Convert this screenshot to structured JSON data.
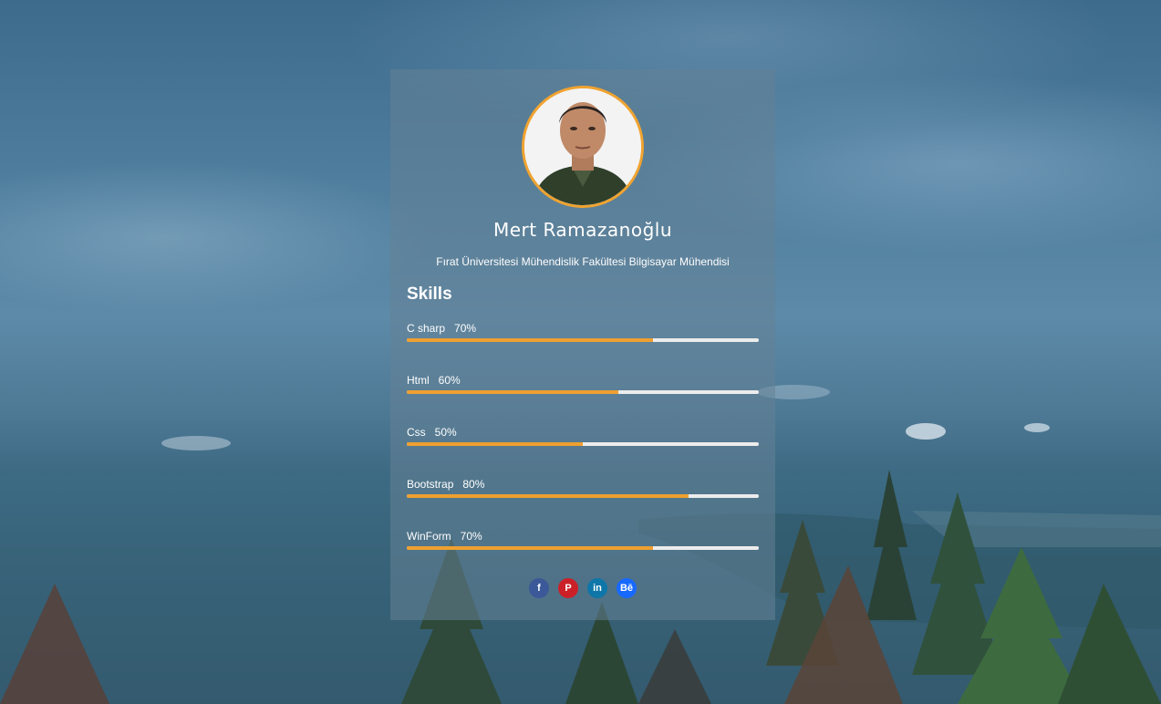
{
  "profile": {
    "name": "Mert Ramazanoğlu",
    "subtitle": "Fırat Üniversitesi Mühendislik Fakültesi Bilgisayar Mühendisi"
  },
  "skills": {
    "title": "Skills",
    "items": [
      {
        "label": "C sharp",
        "percent_text": "70%",
        "percent": 70
      },
      {
        "label": "Html",
        "percent_text": "60%",
        "percent": 60
      },
      {
        "label": "Css",
        "percent_text": "50%",
        "percent": 50
      },
      {
        "label": "Bootstrap",
        "percent_text": "80%",
        "percent": 80
      },
      {
        "label": "WinForm",
        "percent_text": "70%",
        "percent": 70
      }
    ]
  },
  "social": [
    {
      "icon": "facebook-icon",
      "glyph": "f",
      "color": "#3b5998"
    },
    {
      "icon": "pinterest-icon",
      "glyph": "P",
      "color": "#cb2027"
    },
    {
      "icon": "linkedin-icon",
      "glyph": "in",
      "color": "#0e76a8"
    },
    {
      "icon": "behance-icon",
      "glyph": "Bē",
      "color": "#1769ff"
    }
  ],
  "colors": {
    "accent": "#f0a330",
    "progress_fill": "#eea030",
    "progress_track": "#ececec"
  }
}
